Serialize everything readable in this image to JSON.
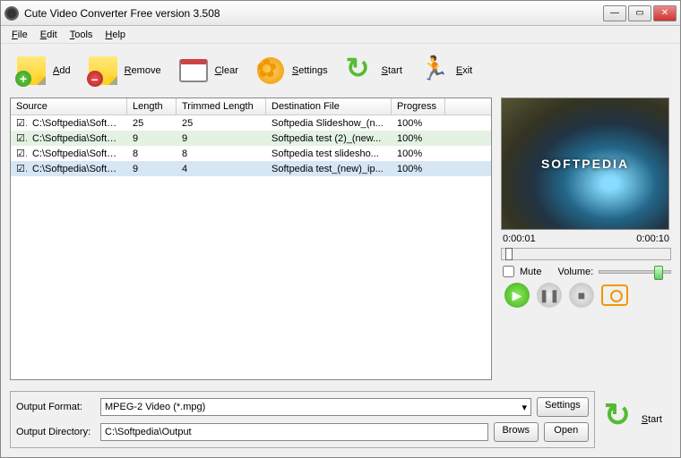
{
  "window": {
    "title": "Cute Video Converter Free version 3.508"
  },
  "menu": {
    "file": "File",
    "edit": "Edit",
    "tools": "Tools",
    "help": "Help"
  },
  "toolbar": {
    "add": "Add",
    "remove": "Remove",
    "clear": "Clear",
    "settings": "Settings",
    "start": "Start",
    "exit": "Exit"
  },
  "columns": {
    "source": "Source",
    "length": "Length",
    "trimmed": "Trimmed Length",
    "dest": "Destination File",
    "progress": "Progress"
  },
  "rows": [
    {
      "checked": true,
      "source": "C:\\Softpedia\\Softpedi...",
      "length": "25",
      "trimmed": "25",
      "dest": "Softpedia Slideshow_(n...",
      "progress": "100%"
    },
    {
      "checked": true,
      "source": "C:\\Softpedia\\Softpedi...",
      "length": "9",
      "trimmed": "9",
      "dest": "Softpedia test (2)_(new...",
      "progress": "100%"
    },
    {
      "checked": true,
      "source": "C:\\Softpedia\\Softpedi...",
      "length": "8",
      "trimmed": "8",
      "dest": "Softpedia test slidesho...",
      "progress": "100%"
    },
    {
      "checked": true,
      "source": "C:\\Softpedia\\Softpedi...",
      "length": "9",
      "trimmed": "4",
      "dest": "Softpedia test_(new)_ip...",
      "progress": "100%"
    }
  ],
  "preview": {
    "watermark": "SOFTPEDIA",
    "time_current": "0:00:01",
    "time_total": "0:00:10",
    "mute": "Mute",
    "volume": "Volume:"
  },
  "output": {
    "format_label": "Output Format:",
    "format_value": "MPEG-2 Video (*.mpg)",
    "dir_label": "Output Directory:",
    "dir_value": "C:\\Softpedia\\Output",
    "settings": "Settings",
    "brows": "Brows",
    "open": "Open"
  },
  "bottom_start": "Start"
}
